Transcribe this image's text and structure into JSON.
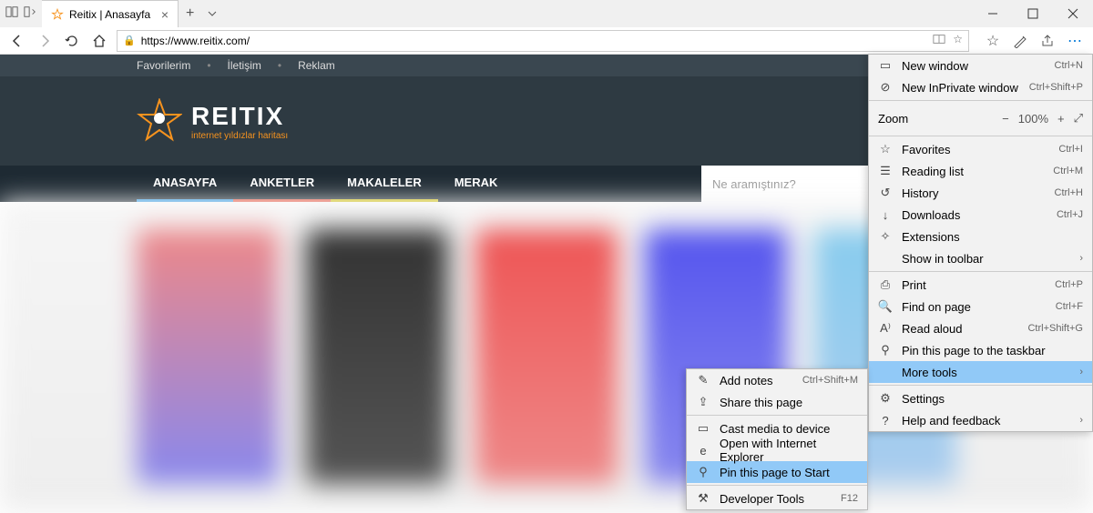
{
  "titlebar": {
    "tab_title": "Reitix | Anasayfa"
  },
  "addrbar": {
    "url": "https://www.reitix.com/"
  },
  "page": {
    "topbar": [
      "Favorilerim",
      "İletişim",
      "Reklam"
    ],
    "logo": {
      "main": "REITIX",
      "sub": "internet yıldızlar haritası"
    },
    "nav": [
      "ANASAYFA",
      "ANKETLER",
      "MAKALELER",
      "MERAK"
    ],
    "search_placeholder": "Ne aramıştınız?"
  },
  "menu": {
    "new_window": "New window",
    "new_window_k": "Ctrl+N",
    "new_inprivate": "New InPrivate window",
    "new_inprivate_k": "Ctrl+Shift+P",
    "zoom": "Zoom",
    "zoom_level": "100%",
    "favorites": "Favorites",
    "favorites_k": "Ctrl+I",
    "reading_list": "Reading list",
    "reading_list_k": "Ctrl+M",
    "history": "History",
    "history_k": "Ctrl+H",
    "downloads": "Downloads",
    "downloads_k": "Ctrl+J",
    "extensions": "Extensions",
    "show_toolbar": "Show in toolbar",
    "print": "Print",
    "print_k": "Ctrl+P",
    "find": "Find on page",
    "find_k": "Ctrl+F",
    "read_aloud": "Read aloud",
    "read_aloud_k": "Ctrl+Shift+G",
    "pin_taskbar": "Pin this page to the taskbar",
    "more_tools": "More tools",
    "settings": "Settings",
    "help": "Help and feedback"
  },
  "submenu": {
    "add_notes": "Add notes",
    "add_notes_k": "Ctrl+Shift+M",
    "share": "Share this page",
    "cast": "Cast media to device",
    "open_ie": "Open with Internet Explorer",
    "pin_start": "Pin this page to Start",
    "devtools": "Developer Tools",
    "devtools_k": "F12"
  }
}
